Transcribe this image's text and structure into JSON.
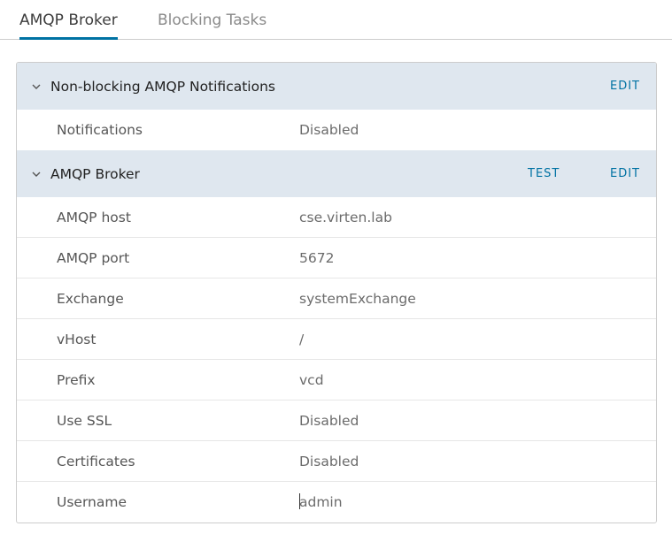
{
  "tabs": [
    {
      "label": "AMQP Broker",
      "active": true
    },
    {
      "label": "Blocking Tasks",
      "active": false
    }
  ],
  "sections": [
    {
      "title": "Non-blocking AMQP Notifications",
      "icon": "chevron-down-icon",
      "actions": {
        "edit": "EDIT"
      },
      "rows": [
        {
          "label": "Notifications",
          "value": "Disabled"
        }
      ]
    },
    {
      "title": "AMQP Broker",
      "icon": "chevron-down-icon",
      "actions": {
        "test": "TEST",
        "edit": "EDIT"
      },
      "rows": [
        {
          "label": "AMQP host",
          "value": "cse.virten.lab"
        },
        {
          "label": "AMQP port",
          "value": "5672"
        },
        {
          "label": "Exchange",
          "value": "systemExchange"
        },
        {
          "label": "vHost",
          "value": "/"
        },
        {
          "label": "Prefix",
          "value": "vcd"
        },
        {
          "label": "Use SSL",
          "value": "Disabled"
        },
        {
          "label": "Certificates",
          "value": "Disabled"
        },
        {
          "label": "Username",
          "value": "admin"
        }
      ]
    }
  ],
  "colors": {
    "accent": "#0072a3",
    "header_background": "#dfe7ef",
    "border": "#cccccc"
  }
}
